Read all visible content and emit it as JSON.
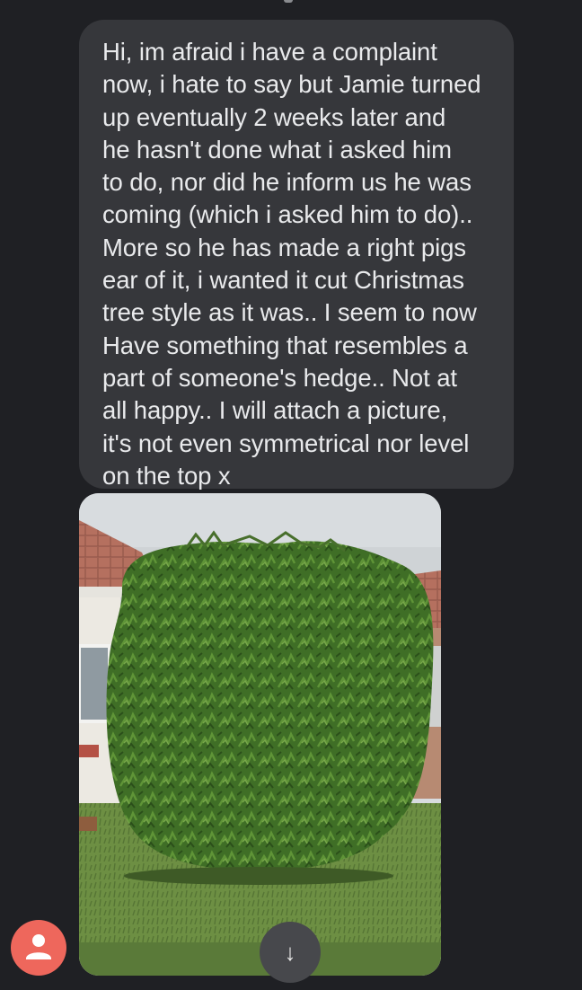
{
  "message": {
    "lines": [
      "Hi, im afraid i have a complaint",
      "now, i hate to say but Jamie turned",
      "up eventually 2 weeks later and",
      "he hasn't done what i asked him",
      "to do, nor did he inform us he was",
      "coming (which i asked him to do)..",
      "More so he has made a right pigs",
      "ear of it, i wanted it cut Christmas",
      "tree style as it was.. I seem to now",
      "Have something that resembles a",
      "part of someone's hedge.. Not at",
      "all happy.. I will attach a picture,",
      "it's not even symmetrical nor level",
      "on the top x"
    ]
  },
  "attachment": {
    "icon": "hedge-photo"
  },
  "avatar": {
    "icon": "person-icon",
    "color": "#ee675c"
  },
  "scroll_button": {
    "glyph": "↓",
    "icon": "arrow-down-icon"
  },
  "colors": {
    "background": "#1f2024",
    "bubble": "#36373b",
    "text": "#e9eaec"
  }
}
